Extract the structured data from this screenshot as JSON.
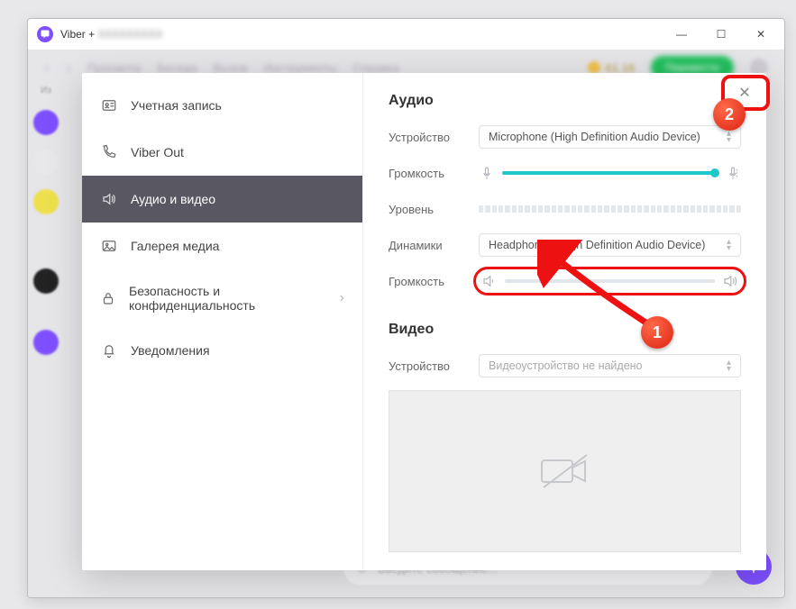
{
  "window": {
    "title_prefix": "Viber +",
    "title_blur": "XXXXXXXXX"
  },
  "backdrop": {
    "menu": [
      "Просмотр",
      "Беседа",
      "Вызов",
      "Инструменты",
      "Справка"
    ],
    "balance": "61.16",
    "green_btn": "Перевести",
    "sidebar_label": "Из"
  },
  "sidebar": {
    "items": [
      {
        "label": "Учетная запись",
        "icon": "id-card-icon"
      },
      {
        "label": "Viber Out",
        "icon": "phone-icon"
      },
      {
        "label": "Аудио и видео",
        "icon": "speaker-icon",
        "active": true
      },
      {
        "label": "Галерея медиа",
        "icon": "gallery-icon"
      },
      {
        "label": "Безопасность и конфиденциальность",
        "icon": "lock-icon",
        "chev": true
      },
      {
        "label": "Уведомления",
        "icon": "bell-icon"
      }
    ]
  },
  "audio": {
    "title": "Аудио",
    "device_label": "Устройство",
    "device_value": "Microphone (High Definition Audio Device)",
    "mic_volume_label": "Громкость",
    "level_label": "Уровень",
    "speakers_label": "Динамики",
    "speakers_value": "Headphones (High Definition Audio Device)",
    "spk_volume_label": "Громкость"
  },
  "video": {
    "title": "Видео",
    "device_label": "Устройство",
    "device_value": "Видеоустройство не найдено"
  },
  "annotations": {
    "badge1": "1",
    "badge2": "2"
  }
}
